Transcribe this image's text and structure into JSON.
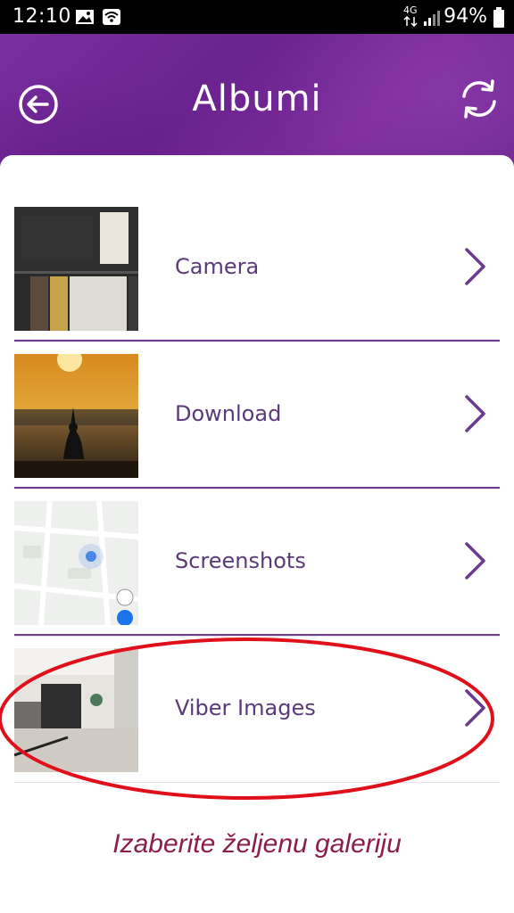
{
  "status_bar": {
    "time": "12:10",
    "network": "4G",
    "battery": "94%"
  },
  "header": {
    "title": "Albumi",
    "back_icon": "arrow-left-circle-icon",
    "refresh_icon": "refresh-icon"
  },
  "albums": [
    {
      "label": "Camera"
    },
    {
      "label": "Download"
    },
    {
      "label": "Screenshots"
    },
    {
      "label": "Viber Images"
    }
  ],
  "annotation": {
    "text": "Izaberite željenu galeriju",
    "color": "#8b1d4a",
    "highlight_color": "#e0101a"
  },
  "colors": {
    "header_purple": "#6c2591",
    "label_purple": "#5a3a78",
    "chevron_purple": "#6a3a8c",
    "divider_purple": "#6d3a8e"
  }
}
